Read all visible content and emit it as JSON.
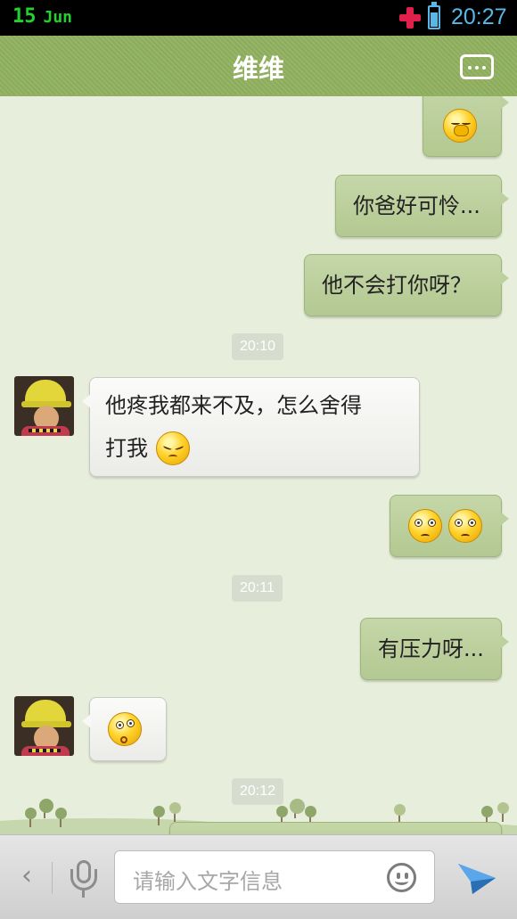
{
  "status_bar": {
    "day": "15",
    "month": "Jun",
    "time": "20:27",
    "icons": [
      "medical-cross-icon",
      "battery-icon"
    ]
  },
  "header": {
    "title": "维维",
    "menu_icon": "chat-menu-icon"
  },
  "chat": {
    "messages": [
      {
        "side": "right",
        "type": "emoji",
        "emoji": [
          "yawn-emoji"
        ]
      },
      {
        "side": "right",
        "type": "text",
        "text": "你爸好可怜..."
      },
      {
        "side": "right",
        "type": "text",
        "text": "他不会打你呀？"
      },
      {
        "type": "timestamp",
        "text": "20:10"
      },
      {
        "side": "left",
        "type": "text",
        "lines": [
          "他疼我都来不及，怎么舍得",
          "打我"
        ],
        "emoji": [
          "shy-emoji"
        ]
      },
      {
        "side": "right",
        "type": "emoji",
        "emoji": [
          "angry-emoji",
          "angry-emoji"
        ]
      },
      {
        "type": "timestamp",
        "text": "20:11"
      },
      {
        "side": "right",
        "type": "text",
        "text": "有压力呀..."
      },
      {
        "side": "left",
        "type": "emoji",
        "emoji": [
          "dizzy-emoji"
        ]
      },
      {
        "type": "timestamp",
        "text": "20:12"
      }
    ]
  },
  "input_bar": {
    "placeholder": "请输入文字信息",
    "back_icon": "chevron-left-icon",
    "mic_icon": "microphone-icon",
    "emoji_icon": "smiley-icon",
    "send_icon": "send-icon"
  },
  "colors": {
    "header_green": "#8fae60",
    "chat_background": "#e7efdc",
    "outgoing_bubble": "#bdd09f",
    "incoming_bubble": "#f5f5f3",
    "status_time": "#58b8e8",
    "status_date": "#22d22c"
  }
}
